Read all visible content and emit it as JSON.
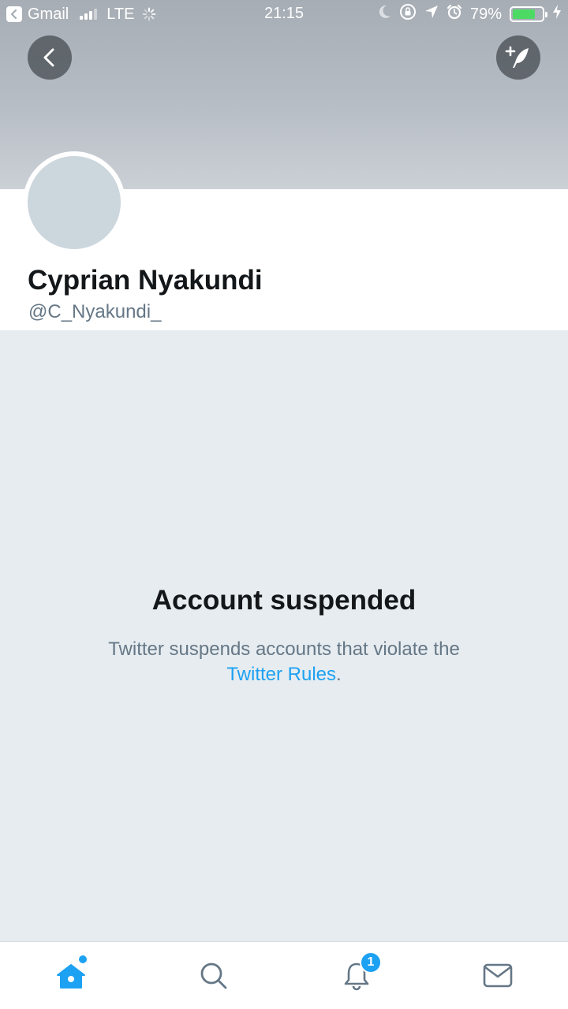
{
  "status_bar": {
    "back_app": "Gmail",
    "network": "LTE",
    "time": "21:15",
    "battery_percent": "79%",
    "battery_level": 0.79
  },
  "profile": {
    "name": "Cyprian Nyakundi",
    "handle": "@C_Nyakundi_"
  },
  "suspension": {
    "title": "Account suspended",
    "message": "Twitter suspends accounts that violate the",
    "link_text": "Twitter Rules",
    "trailing": "."
  },
  "tab_bar": {
    "notification_count": "1"
  },
  "colors": {
    "accent": "#1da1f2",
    "background": "#e6ecf0",
    "banner": "#b7bdc4",
    "avatar_placeholder": "#ccd6dd"
  },
  "icons": [
    "back-icon",
    "compose-icon",
    "home-icon",
    "search-icon",
    "bell-icon",
    "mail-icon"
  ]
}
